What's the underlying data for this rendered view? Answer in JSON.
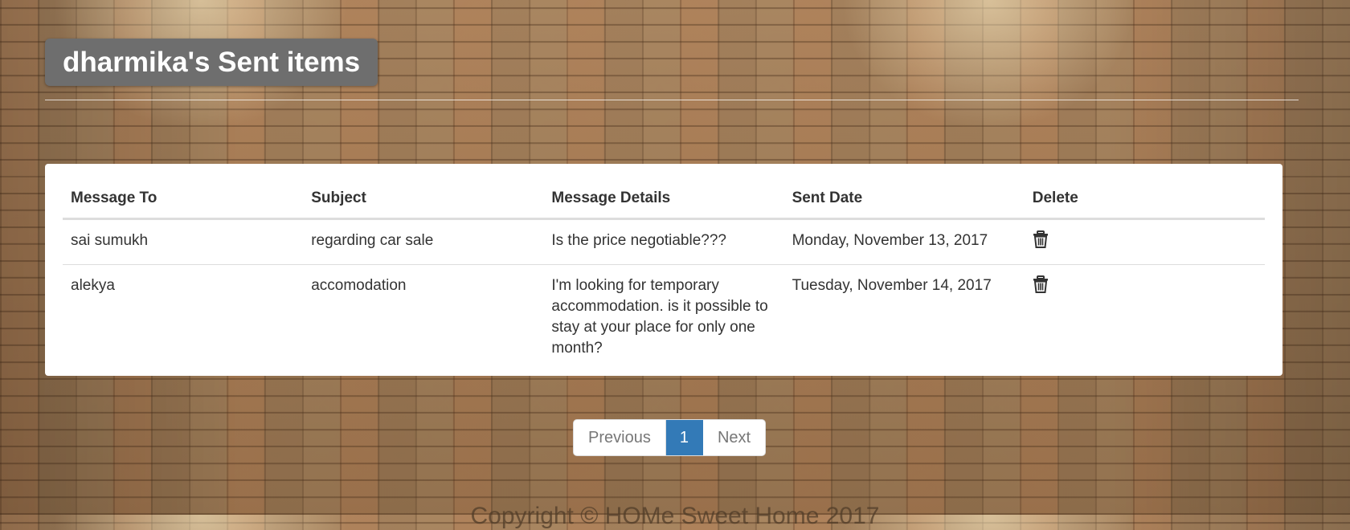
{
  "page": {
    "title": "dharmika's Sent items",
    "footer": "Copyright © HOMe Sweet Home 2017"
  },
  "table": {
    "headers": {
      "to": "Message To",
      "subject": "Subject",
      "details": "Message Details",
      "date": "Sent Date",
      "delete": "Delete"
    },
    "rows": [
      {
        "to": "sai sumukh",
        "subject": "regarding car sale",
        "details": "Is the price negotiable???",
        "date": "Monday, November 13, 2017",
        "delete_icon": "trash-icon"
      },
      {
        "to": "alekya",
        "subject": "accomodation",
        "details": "I'm looking for temporary accommodation. is it possible to stay at your place for only one month?",
        "date": "Tuesday, November 14, 2017",
        "delete_icon": "trash-icon"
      }
    ]
  },
  "pagination": {
    "previous": "Previous",
    "current": "1",
    "next": "Next"
  },
  "colors": {
    "title_bg": "#6e6e6e",
    "active_page": "#337ab7"
  }
}
